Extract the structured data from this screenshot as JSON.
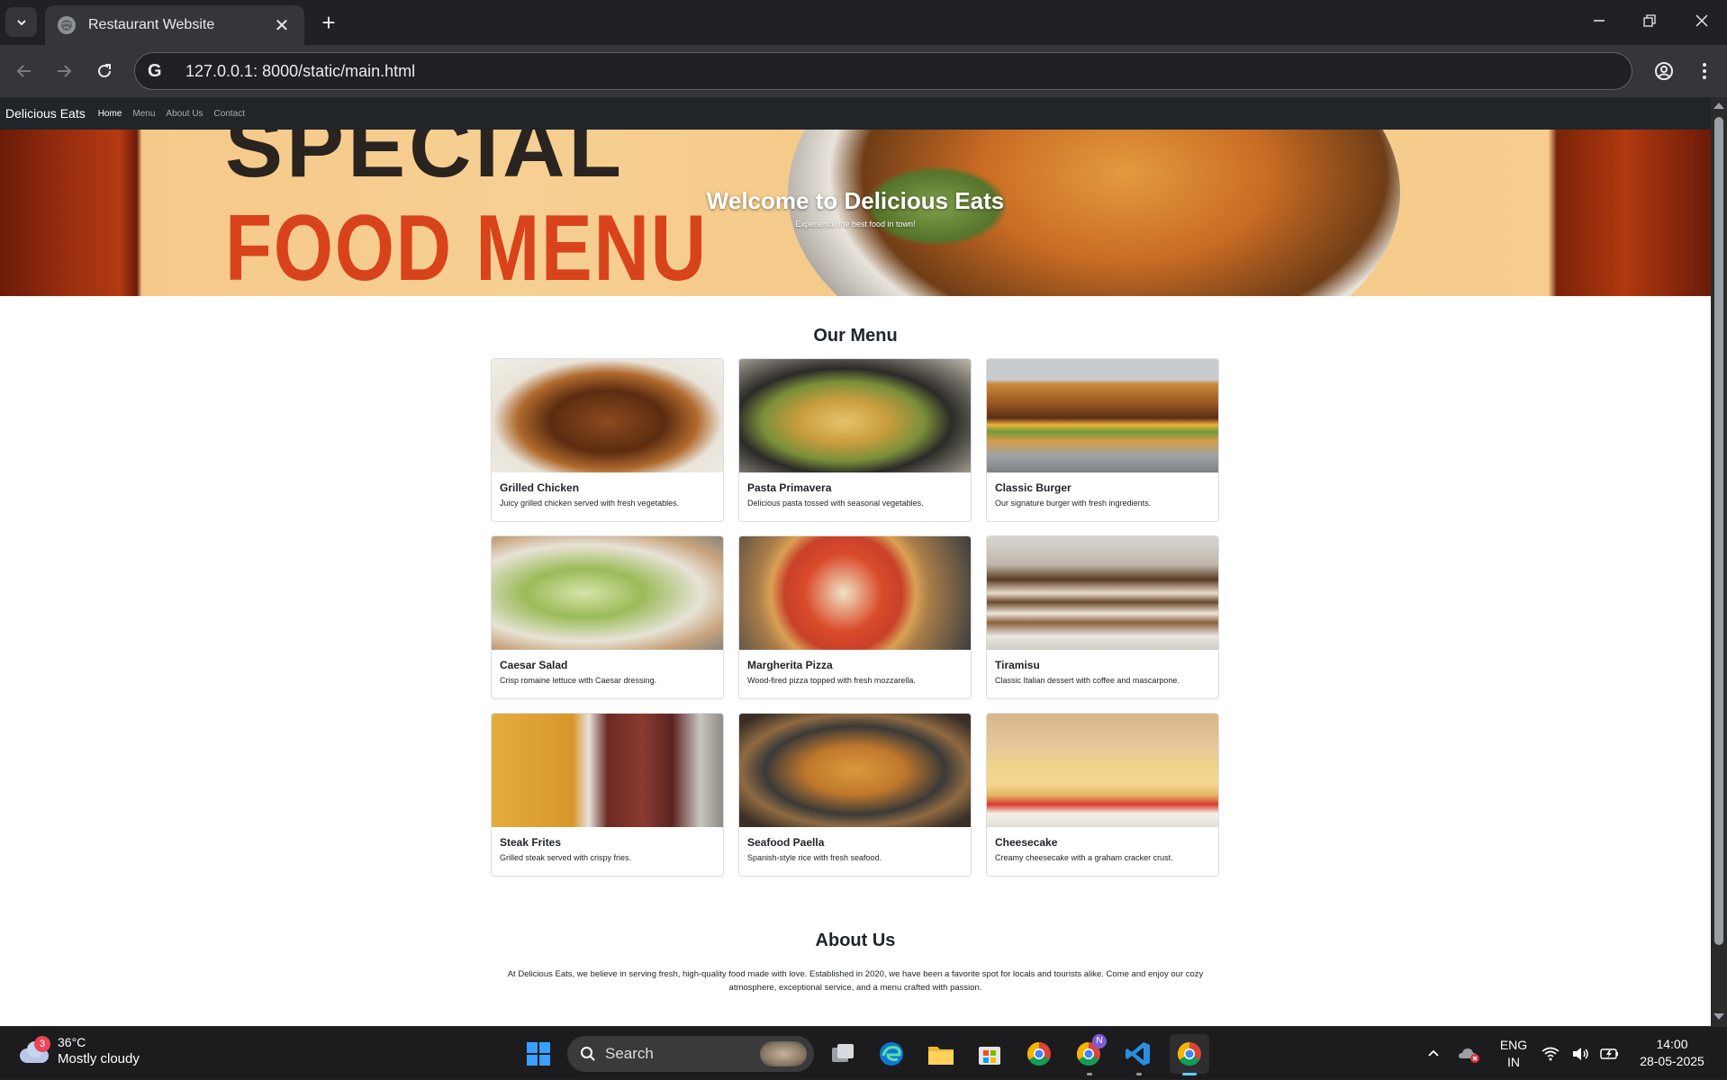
{
  "browser": {
    "tab_title": "Restaurant Website",
    "url": "127.0.0.1: 8000/static/main.html",
    "new_tab_label": "+"
  },
  "site": {
    "brand": "Delicious Eats",
    "nav": [
      "Home",
      "Menu",
      "About Us",
      "Contact"
    ],
    "hero_title": "Welcome to Delicious Eats",
    "hero_subtitle": "Experience the best food in town!",
    "hero_image_text_1": "SPECIAL",
    "hero_image_text_2": "FOOD MENU",
    "menu_title": "Our Menu",
    "menu_items": [
      {
        "name": "Grilled Chicken",
        "desc": "Juicy grilled chicken served with fresh vegetables.",
        "img": "f-grilled"
      },
      {
        "name": "Pasta Primavera",
        "desc": "Delicious pasta tossed with seasonal vegetables.",
        "img": "f-pasta"
      },
      {
        "name": "Classic Burger",
        "desc": "Our signature burger with fresh ingredients.",
        "img": "f-burger"
      },
      {
        "name": "Caesar Salad",
        "desc": "Crisp romaine lettuce with Caesar dressing.",
        "img": "f-salad"
      },
      {
        "name": "Margherita Pizza",
        "desc": "Wood-fired pizza topped with fresh mozzarella.",
        "img": "f-pizza"
      },
      {
        "name": "Tiramisu",
        "desc": "Classic Italian dessert with coffee and mascarpone.",
        "img": "f-tiramisu"
      },
      {
        "name": "Steak Frites",
        "desc": "Grilled steak served with crispy fries.",
        "img": "f-steak"
      },
      {
        "name": "Seafood Paella",
        "desc": "Spanish-style rice with fresh seafood.",
        "img": "f-paella"
      },
      {
        "name": "Cheesecake",
        "desc": "Creamy cheesecake with a graham cracker crust.",
        "img": "f-cheesecake"
      }
    ],
    "about_title": "About Us",
    "about_text": "At Delicious Eats, we believe in serving fresh, high-quality food made with love. Established in 2020, we have been a favorite spot for locals and tourists alike. Come and enjoy our cozy atmosphere, exceptional service, and a menu crafted with passion."
  },
  "taskbar": {
    "weather_badge": "3",
    "temperature": "36°C",
    "condition": "Mostly cloudy",
    "search_label": "Search",
    "chrome_profile_badge": "N",
    "lang_1": "ENG",
    "lang_2": "IN",
    "time": "14:00",
    "date": "28-05-2025"
  },
  "colors": {
    "site_nav_bg": "#212529",
    "browser_bg": "#202124",
    "taskbar_accent": "#60cdff"
  }
}
